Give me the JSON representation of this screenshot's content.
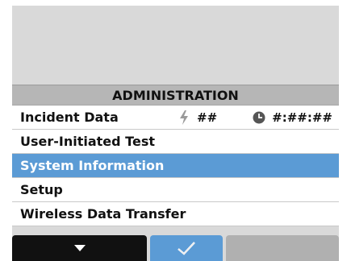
{
  "menu": {
    "title": "ADMINISTRATION",
    "items": [
      {
        "label": "Incident Data",
        "count": "##",
        "time": "#:##:##"
      },
      {
        "label": "User-Initiated Test"
      },
      {
        "label": "System Information",
        "selected": true
      },
      {
        "label": "Setup"
      },
      {
        "label": "Wireless Data Transfer"
      }
    ]
  },
  "icons": {
    "incident": "lightning-bolt-icon",
    "time": "clock-icon",
    "softkey_left": "down-arrow-icon",
    "softkey_middle": "checkmark-icon"
  },
  "colors": {
    "selected": "#5b9bd5",
    "title_bar": "#b6b6b6",
    "softkey_left": "#111111",
    "softkey_middle": "#5b9bd5",
    "softkey_right": "#b0b0b0"
  }
}
